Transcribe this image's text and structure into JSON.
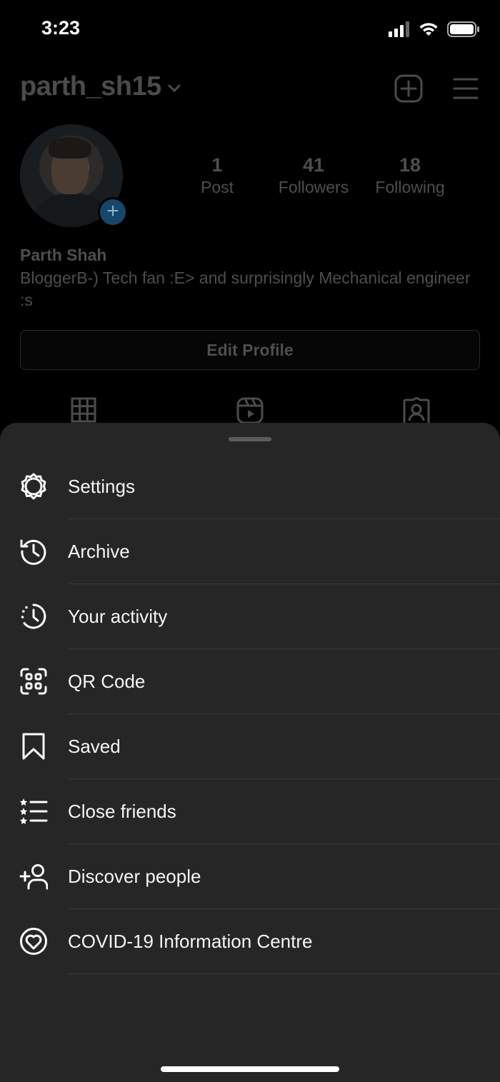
{
  "status_bar": {
    "time": "3:23"
  },
  "profile": {
    "username": "parth_sh15",
    "stats": [
      {
        "value": "1",
        "label": "Post"
      },
      {
        "value": "41",
        "label": "Followers"
      },
      {
        "value": "18",
        "label": "Following"
      }
    ],
    "full_name": "Parth Shah",
    "bio": "BloggerB-) Tech fan :E> and surprisingly Mechanical engineer :s",
    "edit_profile_label": "Edit Profile",
    "tabs": [
      "grid-icon",
      "reels-icon",
      "tagged-icon"
    ]
  },
  "sheet": {
    "menu_items": [
      {
        "label": "Settings",
        "icon": "settings-gear-icon"
      },
      {
        "label": "Archive",
        "icon": "archive-history-icon"
      },
      {
        "label": "Your activity",
        "icon": "activity-clock-icon"
      },
      {
        "label": "QR Code",
        "icon": "qr-code-icon"
      },
      {
        "label": "Saved",
        "icon": "bookmark-icon"
      },
      {
        "label": "Close friends",
        "icon": "close-friends-list-icon"
      },
      {
        "label": "Discover people",
        "icon": "add-person-icon"
      },
      {
        "label": "COVID-19 Information Centre",
        "icon": "covid-heart-icon"
      }
    ]
  }
}
